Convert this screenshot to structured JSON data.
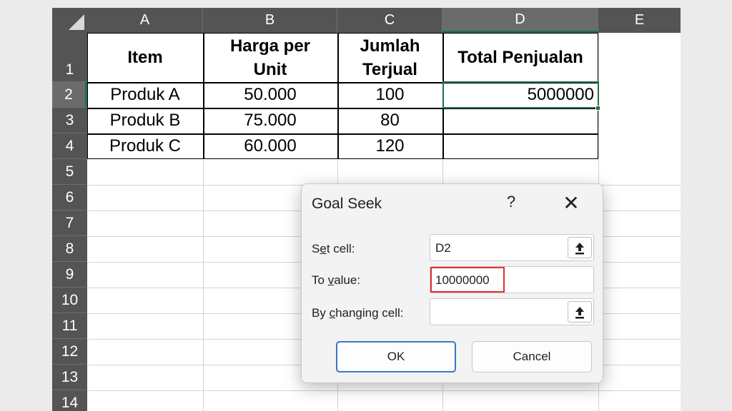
{
  "sheet": {
    "columns": [
      "A",
      "B",
      "C",
      "D",
      "E"
    ],
    "rows": [
      "1",
      "2",
      "3",
      "4",
      "5",
      "6",
      "7",
      "8",
      "9",
      "10",
      "11",
      "12",
      "13",
      "14"
    ],
    "active_cell": "D2"
  },
  "table": {
    "headers": [
      "Item",
      "Harga per Unit",
      "Jumlah Terjual",
      "Total Penjualan"
    ],
    "rows": [
      [
        "Produk A",
        "50.000",
        "100",
        "5000000"
      ],
      [
        "Produk B",
        "75.000",
        "80",
        ""
      ],
      [
        "Produk C",
        "60.000",
        "120",
        ""
      ]
    ]
  },
  "dialog": {
    "title": "Goal Seek",
    "help": "?",
    "close": "✕",
    "set_cell": {
      "label_pre": "S",
      "label_ul": "e",
      "label_post": "t cell:",
      "value": "D2"
    },
    "to_value": {
      "label_pre": "To ",
      "label_ul": "v",
      "label_post": "alue:",
      "value": "10000000"
    },
    "changing_cell": {
      "label_pre": "By ",
      "label_ul": "c",
      "label_post": "hanging cell:",
      "value": ""
    },
    "ok_label": "OK",
    "cancel_label": "Cancel",
    "highlight_color": "#e0312d"
  }
}
